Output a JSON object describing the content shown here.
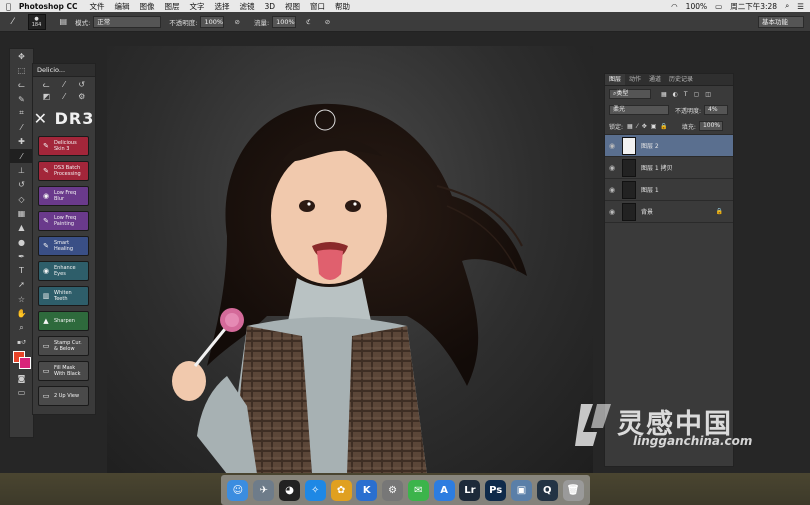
{
  "menubar": {
    "app_name": "Photoshop CC",
    "items": [
      "文件",
      "编辑",
      "图像",
      "图层",
      "文字",
      "选择",
      "滤镜",
      "3D",
      "视图",
      "窗口",
      "帮助"
    ],
    "battery": "100%",
    "clock": "周二下午3:28"
  },
  "options_bar": {
    "brush_size": "184",
    "mode_label": "模式:",
    "mode_value": "正常",
    "opacity_label": "不透明度:",
    "opacity_value": "100%",
    "flow_label": "流量:",
    "flow_value": "100%",
    "workspace": "基本功能"
  },
  "dr3_panel": {
    "tab_title": "Delicio...",
    "logo": "DR3",
    "buttons": [
      {
        "label1": "Delicious",
        "label2": "Skin 3",
        "icon": "✎",
        "color": "#a3263a"
      },
      {
        "label1": "DS3 Batch",
        "label2": "Processing",
        "icon": "✎",
        "color": "#a3263a"
      },
      {
        "label1": "Low Freq",
        "label2": "Blur",
        "icon": "◉",
        "color": "#6a3a8c"
      },
      {
        "label1": "Low Freq",
        "label2": "Painting",
        "icon": "✎",
        "color": "#6a3a8c"
      },
      {
        "label1": "Smart",
        "label2": "Healing",
        "icon": "✎",
        "color": "#3a4f86"
      },
      {
        "label1": "Enhance",
        "label2": "Eyes",
        "icon": "◉",
        "color": "#2e5e6a"
      },
      {
        "label1": "Whiten",
        "label2": "Teeth",
        "icon": "▥",
        "color": "#2e5e6a"
      },
      {
        "label1": "Sharpen",
        "label2": "",
        "icon": "▲",
        "color": "#2e6a3c"
      },
      {
        "label1": "Stamp Cur.",
        "label2": "& Below",
        "icon": "▭",
        "color": "#4a4a4a"
      },
      {
        "label1": "Fill Mask",
        "label2": "With Black",
        "icon": "▭",
        "color": "#4a4a4a"
      },
      {
        "label1": "2 Up View",
        "label2": "",
        "icon": "▭",
        "color": "#4a4a4a"
      }
    ]
  },
  "layers_panel": {
    "tabs": [
      "图层",
      "动作",
      "通道",
      "历史记录"
    ],
    "filter_kind": "类型",
    "blend_mode": "柔光",
    "opacity_label": "不透明度:",
    "opacity_value": "4%",
    "lock_label": "锁定:",
    "fill_label": "填充:",
    "fill_value": "100%",
    "layers": [
      {
        "name": "图层 2",
        "active": true,
        "thumb": "white"
      },
      {
        "name": "图层 1 拷贝",
        "active": false,
        "thumb": "dark"
      },
      {
        "name": "图层 1",
        "active": false,
        "thumb": "dark"
      },
      {
        "name": "背景",
        "active": false,
        "thumb": "dark",
        "locked": true
      }
    ]
  },
  "watermark": {
    "brand": "灵感中国",
    "url": "lingganchina.com"
  },
  "dock": [
    {
      "name": "finder-icon",
      "glyph": "☺",
      "color": "#3b8de0"
    },
    {
      "name": "launchpad-icon",
      "glyph": "✈",
      "color": "#6e7c8a"
    },
    {
      "name": "qq-icon",
      "glyph": "◕",
      "color": "#222"
    },
    {
      "name": "safari-icon",
      "glyph": "✧",
      "color": "#1e88e5"
    },
    {
      "name": "photos-icon",
      "glyph": "✿",
      "color": "#e0a020"
    },
    {
      "name": "k-app-icon",
      "glyph": "K",
      "color": "#2a6fd0"
    },
    {
      "name": "system-preferences-icon",
      "glyph": "⚙",
      "color": "#777"
    },
    {
      "name": "wechat-icon",
      "glyph": "✉",
      "color": "#3cb44b"
    },
    {
      "name": "app-store-icon",
      "glyph": "A",
      "color": "#2d7de0"
    },
    {
      "name": "lightroom-icon",
      "glyph": "Lr",
      "color": "#1d2a3a"
    },
    {
      "name": "photoshop-icon",
      "glyph": "Ps",
      "color": "#0e2a4a"
    },
    {
      "name": "preview-icon",
      "glyph": "▣",
      "color": "#5a7fa8"
    },
    {
      "name": "quicktime-icon",
      "glyph": "Q",
      "color": "#234"
    },
    {
      "name": "trash-icon",
      "glyph": "🗑",
      "color": "#9a9a9a"
    }
  ]
}
